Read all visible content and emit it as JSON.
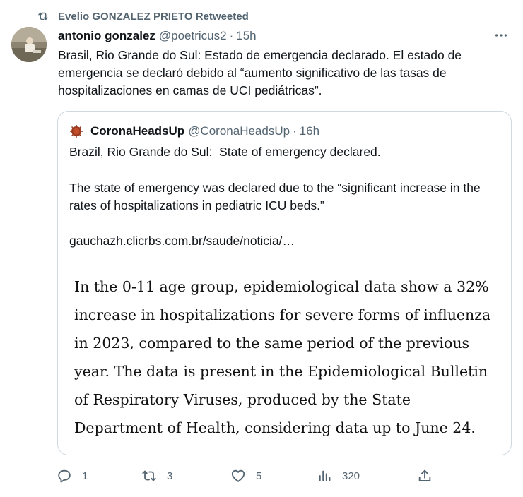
{
  "retweet": {
    "label": "Evelio GONZALEZ PRIETO Retweeted"
  },
  "tweet": {
    "author_name": "antonio gonzalez",
    "author_handle": "@poetricus2",
    "separator": "·",
    "time": "15h",
    "text": "Brasil, Rio Grande do Sul: Estado de emergencia declarado. El estado de emergencia se declaró debido al “aumento significativo de las tasas de hospitalizaciones en camas de UCI pediátricas”."
  },
  "quote": {
    "author_name": "CoronaHeadsUp",
    "author_handle": "@CoronaHeadsUp",
    "separator": "·",
    "time": "16h",
    "line1": "Brazil, Rio Grande do Sul:  State of emergency declared.",
    "paragraph": "The state of emergency was declared due to the “significant increase in the rates of hospitalizations in pediatric ICU beds.”",
    "link": "gauchazh.clicrbs.com.br/saude/noticia/…",
    "image_text": "In the 0-11 age group, epidemiological data show a 32% increase in hospitalizations for severe forms of influenza in 2023, compared to the same period of the previous year. The data is present in the Epidemiological Bulletin of Respiratory Viruses, produced by the State Department of Health, considering data up to June 24."
  },
  "actions": {
    "replies": "1",
    "retweets": "3",
    "likes": "5",
    "views": "320"
  },
  "icons": {
    "retweet": "retweet-icon",
    "more": "more-icon",
    "reply": "reply-icon",
    "like": "heart-icon",
    "views": "views-icon",
    "share": "share-icon"
  },
  "colors": {
    "text": "#0f1419",
    "secondary": "#536471",
    "border": "#cfd9de"
  }
}
